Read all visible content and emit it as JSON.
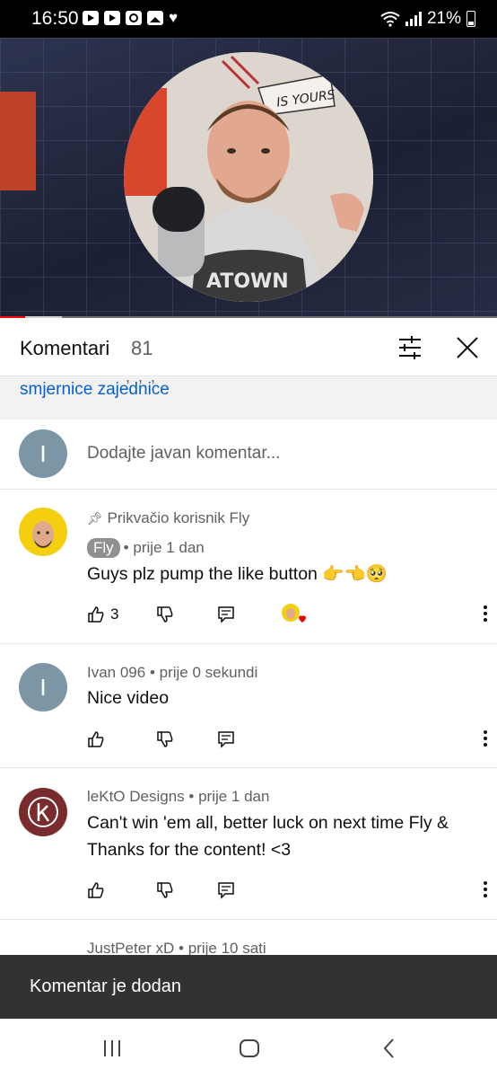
{
  "status_bar": {
    "time": "16:50",
    "battery": "21%"
  },
  "video": {
    "progress_played": 0.05,
    "progress_buffered": 0.125,
    "banner_text": "IS YOURS"
  },
  "comments_panel": {
    "title": "Komentari",
    "count": "81",
    "guidelines_link": "smjernice zajednice",
    "add_avatar_letter": "I",
    "add_placeholder": "Dodajte javan komentar..."
  },
  "comments": [
    {
      "pinned_label": "Prikvačio korisnik Fly",
      "author": "Fly",
      "time": "prije 1 dan",
      "text": "Guys plz pump the like button 👉👈🥺",
      "likes": "3",
      "avatar_color": "#f4cf10"
    },
    {
      "author": "Ivan 096",
      "time": "prije 0 sekundi",
      "text": "Nice video",
      "avatar_letter": "I",
      "avatar_color": "#7d96a5"
    },
    {
      "author": "leKtO Designs",
      "time": "prije 1 dan",
      "text": "Can't win 'em all, better luck on next time Fly & Thanks for the content! <3",
      "avatar_color": "#7a2b2b"
    },
    {
      "author": "JustPeter xD",
      "time": "prije 10 sati"
    }
  ],
  "toast": {
    "text": "Komentar je dodan"
  },
  "colors": {
    "link": "#065fd4",
    "progress": "#ff0000",
    "toast_bg": "#323232"
  },
  "icons": [
    "like-icon",
    "dislike-icon",
    "reply-icon",
    "more-icon",
    "filter-icon",
    "close-icon",
    "pin-icon",
    "heart-badge-icon"
  ]
}
